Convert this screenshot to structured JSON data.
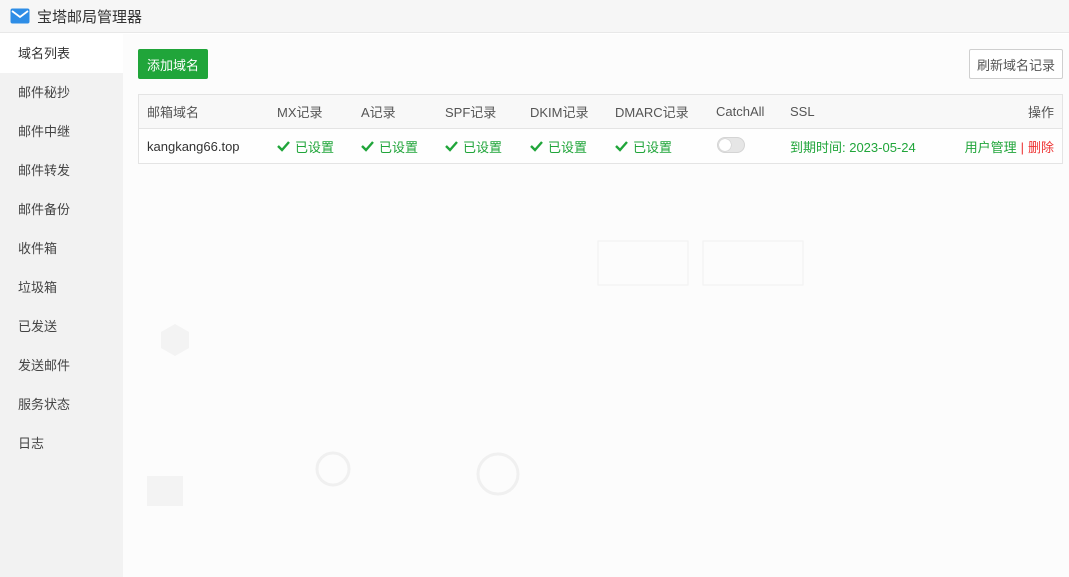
{
  "window": {
    "title": "宝塔邮局管理器",
    "accent": "#20a53a",
    "danger": "#e33333"
  },
  "sidebar": {
    "items": [
      {
        "label": "域名列表",
        "active": true
      },
      {
        "label": "邮件秘抄"
      },
      {
        "label": "邮件中继"
      },
      {
        "label": "邮件转发"
      },
      {
        "label": "邮件备份"
      },
      {
        "label": "收件箱"
      },
      {
        "label": "垃圾箱"
      },
      {
        "label": "已发送"
      },
      {
        "label": "发送邮件"
      },
      {
        "label": "服务状态"
      },
      {
        "label": "日志"
      }
    ]
  },
  "toolbar": {
    "add_label": "添加域名",
    "refresh_label": "刷新域名记录"
  },
  "table": {
    "headers": {
      "domain": "邮箱域名",
      "mx": "MX记录",
      "a": "A记录",
      "spf": "SPF记录",
      "dkim": "DKIM记录",
      "dmarc": "DMARC记录",
      "catchall": "CatchAll",
      "ssl": "SSL",
      "op": "操作"
    },
    "rows": [
      {
        "domain": "kangkang66.top",
        "mx": "已设置",
        "a": "已设置",
        "spf": "已设置",
        "dkim": "已设置",
        "dmarc": "已设置",
        "catchall_on": false,
        "ssl": "到期时间: 2023-05-24",
        "user_manage": "用户管理",
        "separator": "|",
        "delete": "删除"
      }
    ]
  }
}
